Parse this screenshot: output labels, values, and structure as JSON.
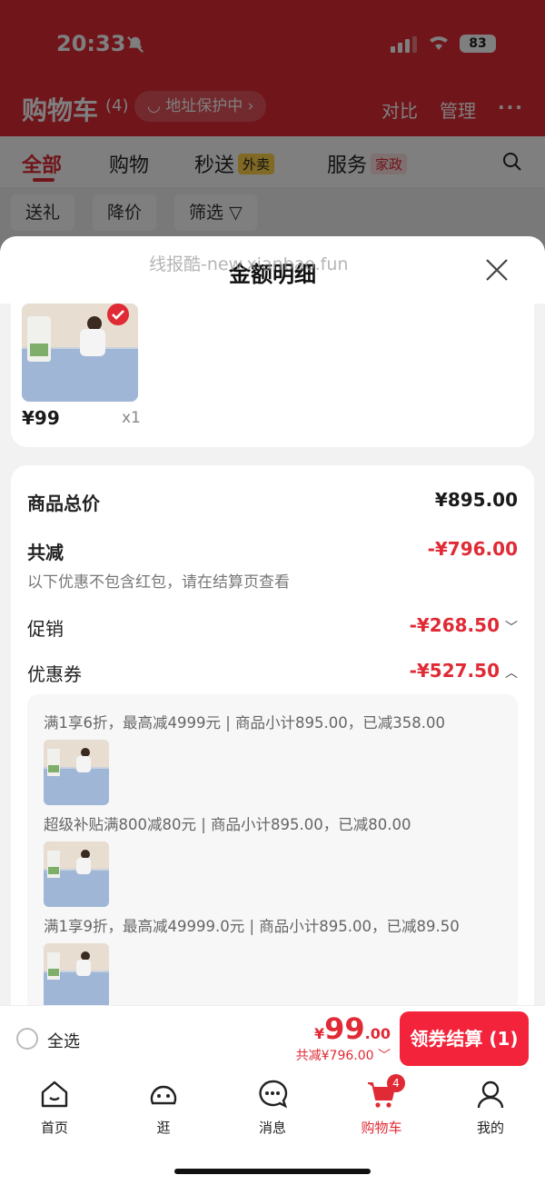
{
  "status_bar": {
    "time": "20:33",
    "battery": "83"
  },
  "cart_header": {
    "title": "购物车",
    "count": "(4)",
    "address_pill": "地址保护中",
    "compare": "对比",
    "manage": "管理",
    "more": "···"
  },
  "category_tabs": [
    {
      "label": "全部",
      "badge": ""
    },
    {
      "label": "购物",
      "badge": ""
    },
    {
      "label": "秒送",
      "badge": "外卖"
    },
    {
      "label": "服务",
      "badge": "家政"
    }
  ],
  "filter_chips": [
    "送礼",
    "降价",
    "筛选"
  ],
  "sheet": {
    "title": "金额明细",
    "watermark": "线报酷-new.xianbao.fun"
  },
  "product": {
    "price": "¥99",
    "qty": "x1"
  },
  "details": {
    "total_label": "商品总价",
    "total_value": "¥895.00",
    "discount_label": "共减",
    "discount_value": "-¥796.00",
    "discount_note": "以下优惠不包含红包，请在结算页查看",
    "promo_label": "促销",
    "promo_value": "-¥268.50",
    "coupon_label": "优惠券",
    "coupon_value": "-¥527.50"
  },
  "coupons": [
    "满1享6折，最高减4999元 | 商品小计895.00，已减358.00",
    "超级补贴满800减80元 | 商品小计895.00，已减80.00",
    "满1享9折，最高减49999.0元 | 商品小计895.00，已减89.50"
  ],
  "checkout": {
    "select_all": "全选",
    "price_symbol": "¥",
    "price_int": "99",
    "price_dec": ".00",
    "saved": "共减¥796.00",
    "button": "领券结算 (1)"
  },
  "tabbar": [
    {
      "label": "首页",
      "icon": "home-icon"
    },
    {
      "label": "逛",
      "icon": "explore-icon"
    },
    {
      "label": "消息",
      "icon": "message-icon"
    },
    {
      "label": "购物车",
      "icon": "cart-icon",
      "badge": "4"
    },
    {
      "label": "我的",
      "icon": "profile-icon"
    }
  ],
  "colors": {
    "brand_red": "#e02a35",
    "button_red": "#f2233a"
  }
}
